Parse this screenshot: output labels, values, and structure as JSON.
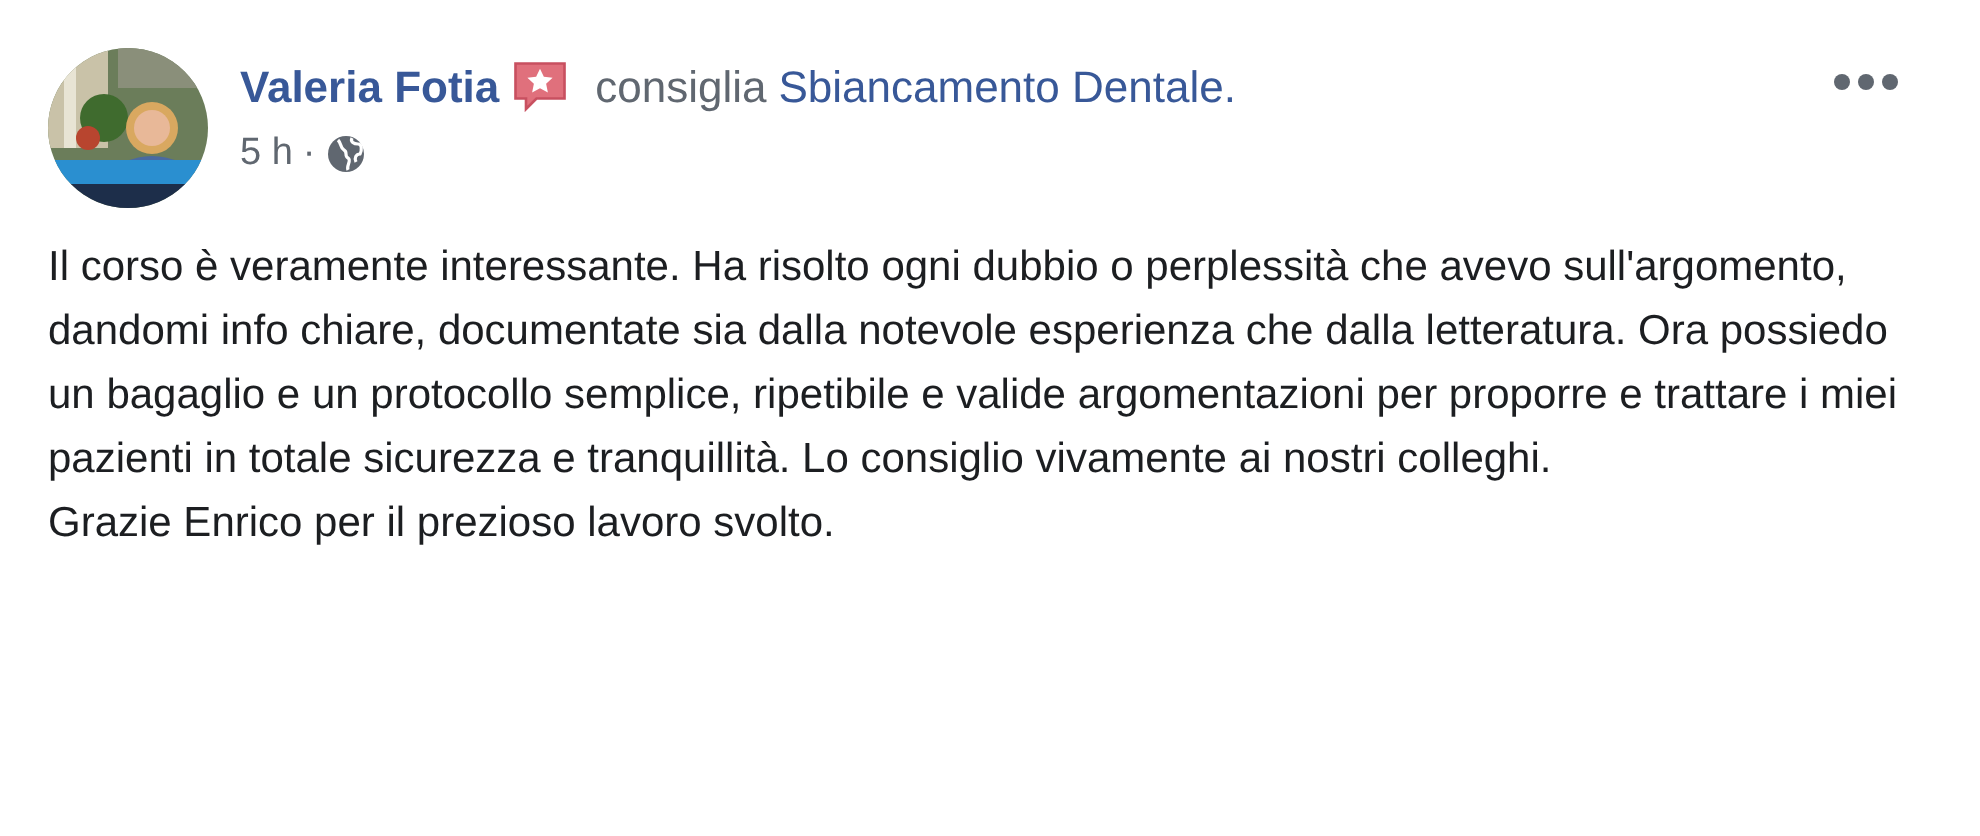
{
  "post": {
    "author": "Valeria Fotia",
    "action": "consiglia",
    "page": "Sbiancamento Dentale.",
    "time": "5 h",
    "separator": "·",
    "paragraphs": [
      "Il corso è veramente interessante. Ha risolto ogni dubbio o perplessità che avevo sull'argomento, dandomi info chiare, documentate sia dalla notevole esperienza che dalla letteratura. Ora possiedo un bagaglio e un protocollo semplice, ripetibile e valide argomentazioni per proporre e trattare i miei pazienti in totale sicurezza e tranquillità. Lo consiglio vivamente ai nostri colleghi.",
      "Grazie Enrico per il prezioso lavoro svolto."
    ]
  }
}
